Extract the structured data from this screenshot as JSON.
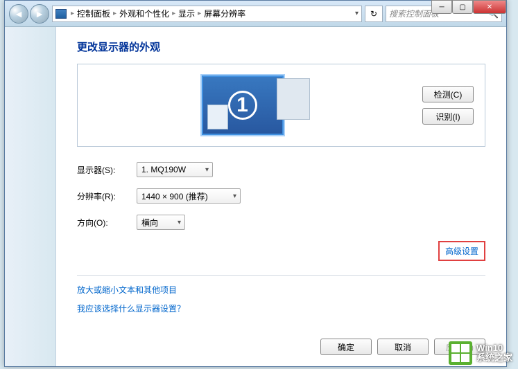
{
  "breadcrumb": {
    "items": [
      "控制面板",
      "外观和个性化",
      "显示",
      "屏幕分辨率"
    ]
  },
  "search": {
    "placeholder": "搜索控制面板"
  },
  "heading": "更改显示器的外观",
  "preview": {
    "monitor_number": "1",
    "detect_btn": "检测(C)",
    "identify_btn": "识别(I)"
  },
  "form": {
    "display_label": "显示器(S):",
    "display_value": "1. MQ190W",
    "resolution_label": "分辨率(R):",
    "resolution_value": "1440 × 900 (推荐)",
    "orientation_label": "方向(O):",
    "orientation_value": "横向"
  },
  "links": {
    "advanced": "高级设置",
    "enlarge": "放大或缩小文本和其他项目",
    "which_display": "我应该选择什么显示器设置？"
  },
  "buttons": {
    "ok": "确定",
    "cancel": "取消",
    "apply": "应用(A)"
  },
  "watermark": {
    "line1": "Win10",
    "line2": "系统之家"
  }
}
